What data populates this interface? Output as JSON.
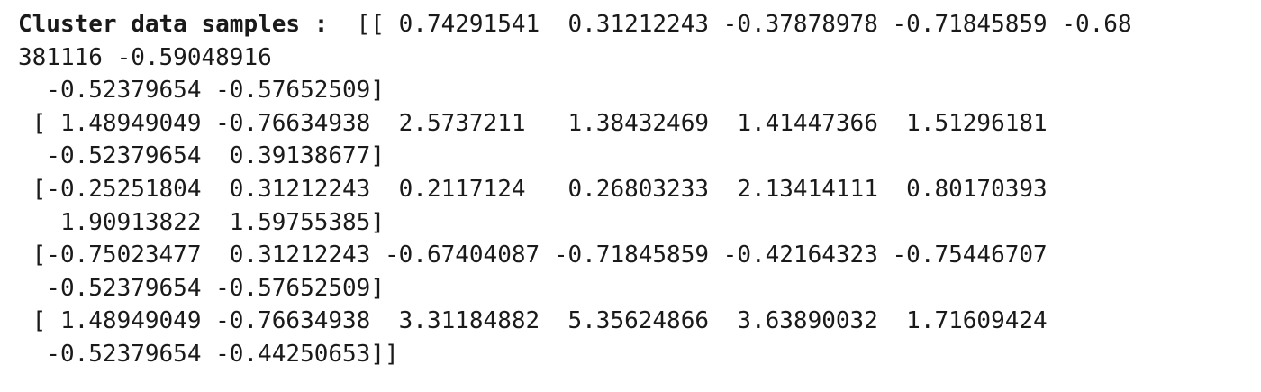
{
  "output": {
    "label": "Cluster data samples :",
    "lines": [
      "  [[ 0.74291541  0.31212243 -0.37878978 -0.71845859 -0.68",
      "381116 -0.59048916",
      "  -0.52379654 -0.57652509]",
      " [ 1.48949049 -0.76634938  2.5737211   1.38432469  1.41447366  1.51296181",
      "  -0.52379654  0.39138677]",
      " [-0.25251804  0.31212243  0.2117124   0.26803233  2.13414111  0.80170393",
      "   1.90913822  1.59755385]",
      " [-0.75023477  0.31212243 -0.67404087 -0.71845859 -0.42164323 -0.75446707",
      "  -0.52379654 -0.57652509]",
      " [ 1.48949049 -0.76634938  3.31184882  5.35624866  3.63890032  1.71609424",
      "  -0.52379654 -0.44250653]]"
    ]
  }
}
